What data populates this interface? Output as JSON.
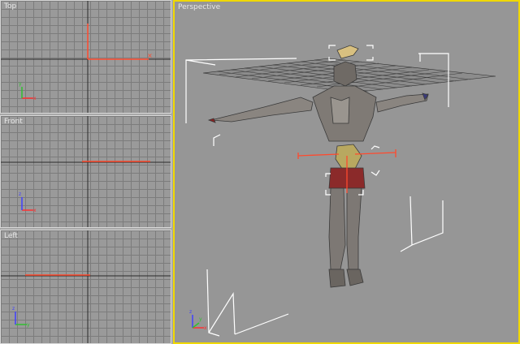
{
  "viewports": {
    "top": {
      "label": "Top"
    },
    "front": {
      "label": "Front"
    },
    "left": {
      "label": "Left"
    },
    "perspective": {
      "label": "Perspective"
    }
  },
  "axis_labels": {
    "x": "x",
    "y": "y",
    "z": "z"
  },
  "colors": {
    "active_border": "#f0d800",
    "selection": "#ff4a2e",
    "axis_x": "#ff3030",
    "axis_y": "#30c030",
    "axis_z": "#4040ff",
    "bracket": "#ffffff"
  }
}
